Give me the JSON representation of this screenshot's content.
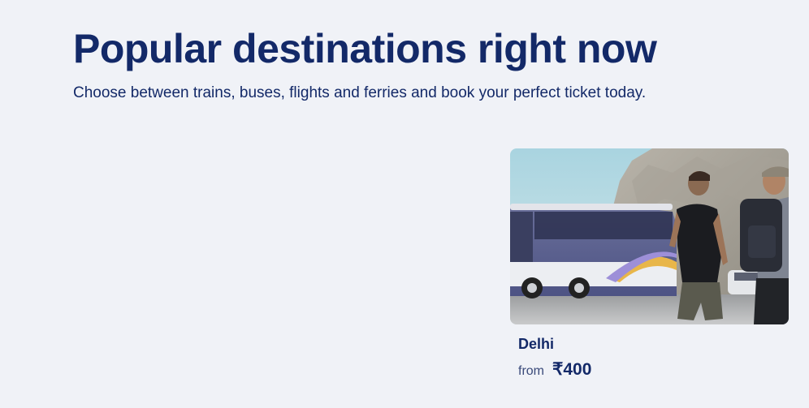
{
  "header": {
    "title": "Popular destinations right now",
    "subtitle": "Choose between trains, buses, flights and ferries and book your perfect ticket today."
  },
  "destinations": [
    {
      "name": "Delhi",
      "from_label": "from",
      "price": "₹400",
      "image": "travelers-walking-toward-bus-photo"
    }
  ]
}
